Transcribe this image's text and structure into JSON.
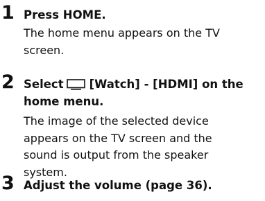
{
  "steps": [
    {
      "number": "1",
      "instruction": "Press HOME.",
      "description": "The home menu appears on the TV screen."
    },
    {
      "number": "2",
      "instruction_prefix": "Select",
      "icon": "tv-icon",
      "instruction_suffix": "[Watch] - [HDMI] on the home menu.",
      "description": "The image of the selected device appears on the TV screen and the sound is output from the speaker system."
    },
    {
      "number": "3",
      "instruction": "Adjust the volume (page 36)."
    }
  ]
}
